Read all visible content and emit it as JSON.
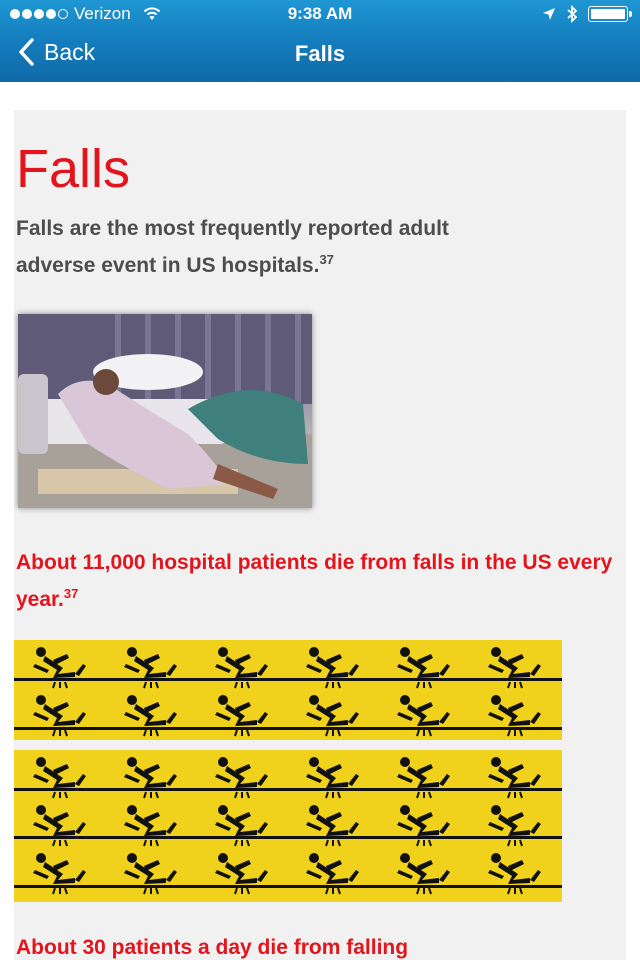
{
  "status_bar": {
    "carrier": "Verizon",
    "time": "9:38 AM"
  },
  "nav": {
    "back_label": "Back",
    "title": "Falls"
  },
  "article": {
    "heading": "Falls",
    "intro_text": "Falls are the most frequently reported adult adverse event in US hospitals.",
    "intro_ref": "37",
    "stat_text": "About 11,000 hospital patients die from falls in the US every year.",
    "stat_ref": "37",
    "bottom_text": "About 30 patients a day die from falling"
  },
  "colors": {
    "nav_blue": "#157fc0",
    "accent_red": "#e3141b",
    "warning_yellow": "#f0d21d",
    "content_bg": "#f1f1f1"
  }
}
